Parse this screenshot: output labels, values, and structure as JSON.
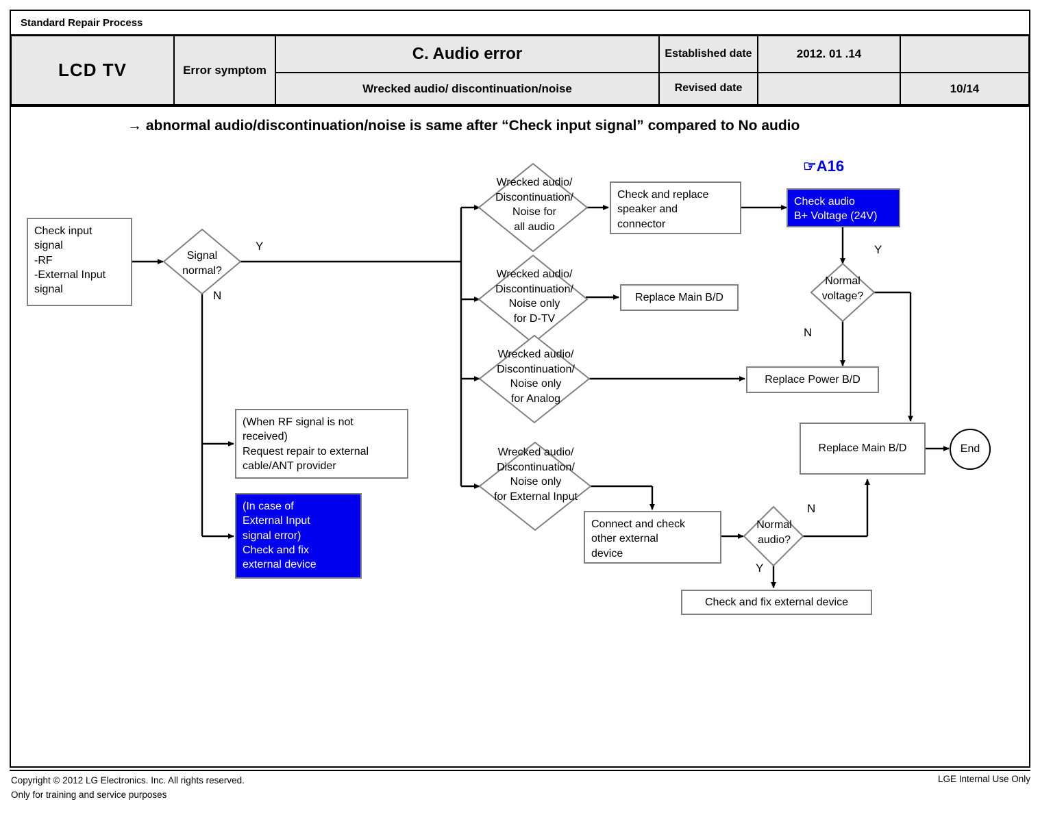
{
  "header": {
    "strip_title": "Standard Repair Process",
    "product": "LCD  TV",
    "error_symptom_label": "Error\nsymptom",
    "title": "C. Audio error",
    "subtitle": "Wrecked audio/ discontinuation/noise",
    "established_date_label": "Established\ndate",
    "established_date_value": "2012. 01 .14",
    "revised_date_label": "Revised date",
    "revised_date_value": "",
    "blank_cell": "",
    "page": "10/14"
  },
  "subheading": "→ abnormal audio/discontinuation/noise is same after “Check input signal” compared to No audio",
  "annotation": {
    "a16": "☞A16",
    "a16_color": "#0000ee"
  },
  "nodes": {
    "check_input_signal": "Check input\nsignal\n-RF\n-External Input\nsignal",
    "signal_normal": "Signal\nnormal?",
    "rf_note": "(When RF signal is not\nreceived)\nRequest repair to external\ncable/ANT provider",
    "external_input_note": "(In case of\nExternal Input\nsignal error)\nCheck and fix\nexternal device",
    "d_all_audio": "Wrecked audio/\nDiscontinuation/\nNoise for\nall audio",
    "d_dtv": "Wrecked audio/\nDiscontinuation/\nNoise only\nfor D-TV",
    "d_analog": "Wrecked audio/\nDiscontinuation/\nNoise only\nfor Analog",
    "d_external": "Wrecked audio/\nDiscontinuation/\nNoise only\nfor External Input",
    "check_replace_speaker": "Check and replace\nspeaker and\nconnector",
    "check_audio_bplus": "Check audio\nB+ Voltage (24V)",
    "replace_main_bd_1": "Replace Main B/D",
    "replace_power_bd": "Replace Power B/D",
    "normal_voltage": "Normal\nvoltage?",
    "replace_main_bd_2": "Replace Main B/D",
    "end": "End",
    "connect_check_other": "Connect and check\nother external\ndevice",
    "normal_audio": "Normal\naudio?",
    "check_fix_external": "Check and fix external device"
  },
  "branch_labels": {
    "signal_normal_y": "Y",
    "signal_normal_n": "N",
    "normal_voltage_y": "Y",
    "normal_voltage_n": "N",
    "normal_audio_n": "N",
    "normal_audio_y": "Y"
  },
  "footer": {
    "line1": "Copyright © 2012 LG Electronics. Inc. All rights reserved.",
    "line2": "Only for training and service purposes",
    "right": "LGE Internal Use Only"
  },
  "colors": {
    "blue_fill": "#0000ee",
    "node_border": "#808080",
    "header_fill": "#e8e8e8",
    "line": "#000000"
  }
}
